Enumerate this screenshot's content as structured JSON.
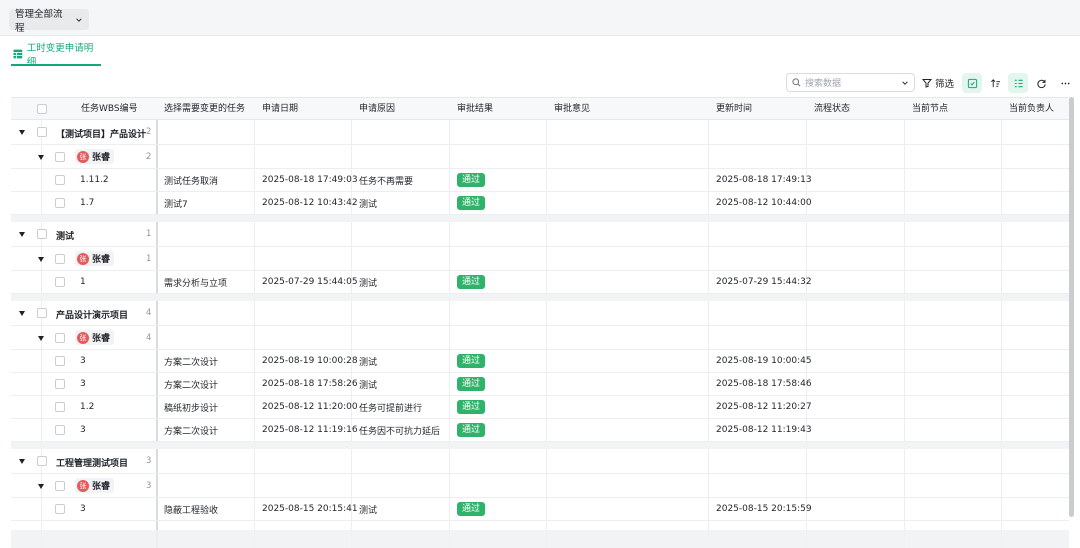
{
  "topbar": {
    "scope_label": "管理全部流程"
  },
  "tab": {
    "label": "工时变更申请明细"
  },
  "toolbar": {
    "search_placeholder": "搜索数据",
    "filter_label": "筛选"
  },
  "columns": [
    "任务WBS编号",
    "选择需要变更的任务",
    "申请日期",
    "申请原因",
    "审批结果",
    "审批意见",
    "更新时间",
    "流程状态",
    "当前节点",
    "当前负责人"
  ],
  "groups": [
    {
      "title": "【测试项目】产品设计",
      "count": "2",
      "user": "张睿",
      "avatar_text": "张",
      "user_count": "2",
      "rows": [
        {
          "wbs": "1.11.2",
          "task": "测试任务取消",
          "date": "2025-08-18 17:49:03",
          "reason": "任务不再需要",
          "result": "通过",
          "updated": "2025-08-18 17:49:13"
        },
        {
          "wbs": "1.7",
          "task": "测试7",
          "date": "2025-08-12 10:43:42",
          "reason": "测试",
          "result": "通过",
          "updated": "2025-08-12 10:44:00"
        }
      ]
    },
    {
      "title": "测试",
      "count": "1",
      "user": "张睿",
      "avatar_text": "张",
      "user_count": "1",
      "rows": [
        {
          "wbs": "1",
          "task": "需求分析与立项",
          "date": "2025-07-29 15:44:05",
          "reason": "测试",
          "result": "通过",
          "updated": "2025-07-29 15:44:32"
        }
      ]
    },
    {
      "title": "产品设计演示项目",
      "count": "4",
      "user": "张睿",
      "avatar_text": "张",
      "user_count": "4",
      "rows": [
        {
          "wbs": "3",
          "task": "方案二次设计",
          "date": "2025-08-19 10:00:28",
          "reason": "测试",
          "result": "通过",
          "updated": "2025-08-19 10:00:45"
        },
        {
          "wbs": "3",
          "task": "方案二次设计",
          "date": "2025-08-18 17:58:26",
          "reason": "测试",
          "result": "通过",
          "updated": "2025-08-18 17:58:46"
        },
        {
          "wbs": "1.2",
          "task": "稿纸初步设计",
          "date": "2025-08-12 11:20:00",
          "reason": "任务可提前进行",
          "result": "通过",
          "updated": "2025-08-12 11:20:27"
        },
        {
          "wbs": "3",
          "task": "方案二次设计",
          "date": "2025-08-12 11:19:16",
          "reason": "任务因不可抗力延后",
          "result": "通过",
          "updated": "2025-08-12 11:19:43"
        }
      ]
    },
    {
      "title": "工程管理测试项目",
      "count": "3",
      "user": "张睿",
      "avatar_text": "张",
      "user_count": "3",
      "rows": [
        {
          "wbs": "3",
          "task": "隐蔽工程验收",
          "date": "2025-08-15 20:15:41",
          "reason": "测试",
          "result": "通过",
          "updated": "2025-08-15 20:15:59"
        }
      ]
    }
  ],
  "colors": {
    "accent": "#14a97c",
    "pass": "#2fb36b",
    "avatar": "#e35b5b"
  }
}
